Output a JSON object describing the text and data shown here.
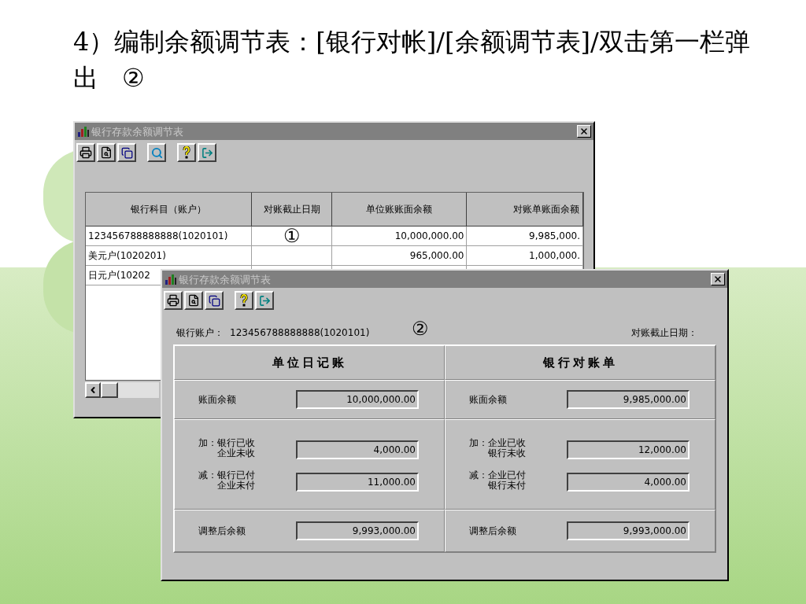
{
  "heading": {
    "text": "4）编制余额调节表：[银行对帐]/[余额调节表]/双击第一栏弹出",
    "marker": "②"
  },
  "list_window": {
    "title": "银行存款余额调节表",
    "columns": [
      "银行科目（账户）",
      "对账截止日期",
      "单位账账面余额",
      "对账单账面余额"
    ],
    "rows": [
      {
        "account": "123456788888888(1020101)",
        "callout": "①",
        "book_balance": "10,000,000.00",
        "statement_balance": "9,985,000."
      },
      {
        "account": "美元户(1020201)",
        "book_balance": "965,000.00",
        "statement_balance": "1,000,000."
      },
      {
        "account": "日元户(10202"
      }
    ]
  },
  "detail_window": {
    "title": "银行存款余额调节表",
    "account_label": "银行账户：",
    "account": "123456788888888(1020101)",
    "callout": "②",
    "date_label": "对账截止日期：",
    "sides": [
      {
        "heading": "单位日记账",
        "balance": {
          "label": "账面余额",
          "value": "10,000,000.00"
        },
        "adjustments": [
          {
            "prefix": "加：",
            "lines": [
              "银行已收",
              "企业未收"
            ],
            "value": "4,000.00"
          },
          {
            "prefix": "减：",
            "lines": [
              "银行已付",
              "企业未付"
            ],
            "value": "11,000.00"
          }
        ],
        "adjusted": {
          "label": "调整后余额",
          "value": "9,993,000.00"
        }
      },
      {
        "heading": "银行对账单",
        "balance": {
          "label": "账面余额",
          "value": "9,985,000.00"
        },
        "adjustments": [
          {
            "prefix": "加：",
            "lines": [
              "企业已收",
              "银行未收"
            ],
            "value": "12,000.00"
          },
          {
            "prefix": "减：",
            "lines": [
              "企业已付",
              "银行未付"
            ],
            "value": "4,000.00"
          }
        ],
        "adjusted": {
          "label": "调整后余额",
          "value": "9,993,000.00"
        }
      }
    ]
  }
}
